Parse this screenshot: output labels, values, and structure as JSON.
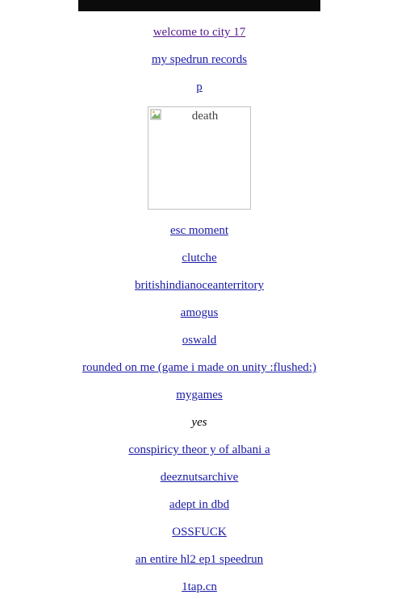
{
  "links_top": [
    "welcome to city 17",
    "my spedrun records",
    "p"
  ],
  "image": {
    "alt": "death"
  },
  "links_bottom": [
    "esc moment",
    "clutche",
    "britishindianoceanterritory",
    "amogus",
    "oswald",
    "rounded on me (game i made on unity :flushed:)",
    "mygames"
  ],
  "emphasis": "yes",
  "links_final": [
    "conspiricy theor y of albani a",
    "deeznutsarchive",
    "adept in dbd",
    "OSSFUCK",
    "an entire hl2 ep1 speedrun",
    "1tap.cn"
  ],
  "colors": {
    "link": "#1a1aa6",
    "visited": "#551a8b",
    "banner": "#0b0b0b"
  }
}
